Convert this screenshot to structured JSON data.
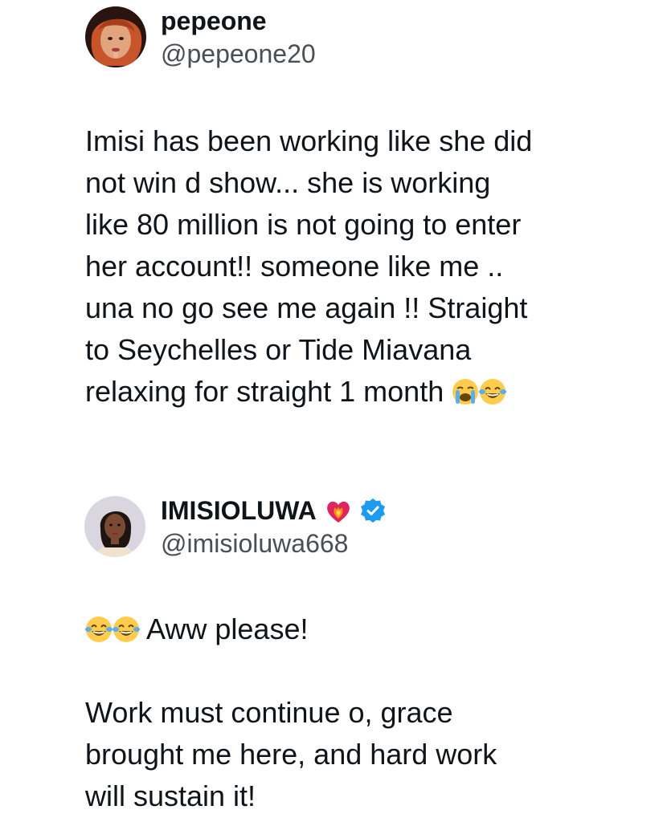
{
  "tweets": [
    {
      "display_name": "pepeone",
      "handle": "@pepeone20",
      "avatar_icon": "profile-photo-woman-red-hair",
      "body_lines": [
        "Imisi has been working like she did",
        "not win d show... she is working",
        "like 80 million is not going to enter",
        "her account!! someone like me ..",
        "una no go see me again !! Straight",
        "to Seychelles or Tide Miavana",
        "relaxing for straight 1 month"
      ],
      "trailing_emojis": [
        "loudly-crying-face",
        "face-with-tears-of-joy"
      ]
    },
    {
      "display_name": "IMISIOLUWA",
      "handle": "@imisioluwa668",
      "avatar_icon": "profile-photo-woman",
      "name_icons": [
        "heart-on-fire-icon",
        "verified-badge-icon"
      ],
      "leading_emojis": [
        "face-with-tears-of-joy",
        "face-with-tears-of-joy"
      ],
      "first_line": "Aww please!",
      "paragraph_lines": [
        "Work must continue o, grace",
        "brought me here, and hard work",
        "will sustain it!"
      ]
    }
  ],
  "colors": {
    "text": "#0f1419",
    "handle": "#4a4f55",
    "verified": "#1d9bf0",
    "heart": "#e0245e"
  }
}
